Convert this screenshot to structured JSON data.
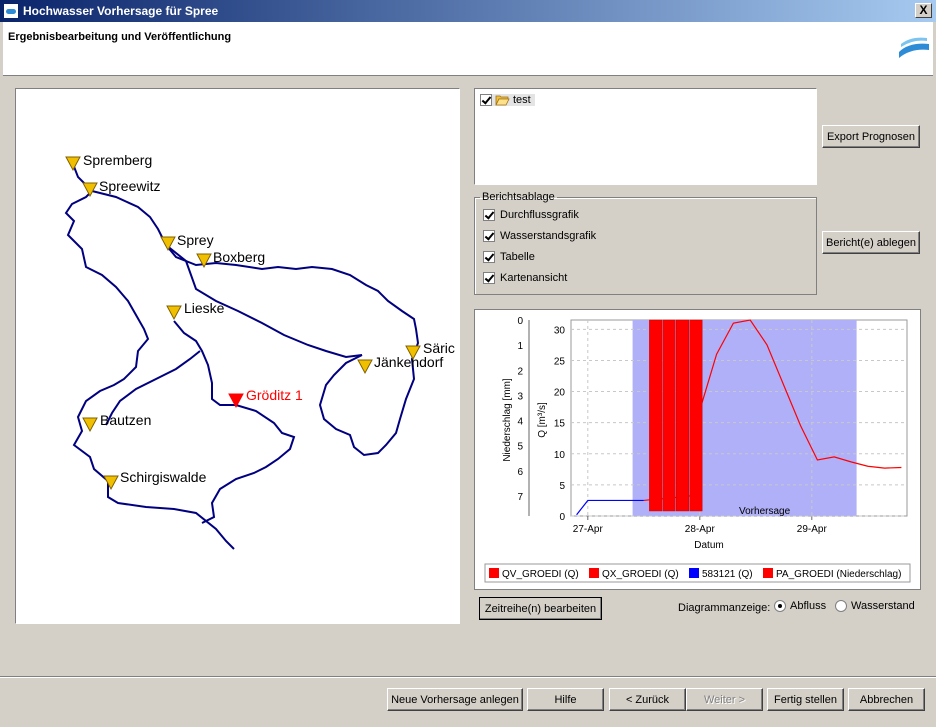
{
  "window": {
    "title": "Hochwasser Vorhersage für Spree",
    "close_label": "X"
  },
  "header": {
    "subtitle": "Ergebnisbearbeitung und Veröffentlichung"
  },
  "map": {
    "stations": [
      {
        "name": "Spremberg",
        "highlight": false
      },
      {
        "name": "Spreewitz",
        "highlight": false
      },
      {
        "name": "Sprey",
        "highlight": false
      },
      {
        "name": "Boxberg",
        "highlight": false
      },
      {
        "name": "Lieske",
        "highlight": false
      },
      {
        "name": "Särichen",
        "label": "Säric",
        "highlight": false
      },
      {
        "name": "Jänkendorf",
        "highlight": false
      },
      {
        "name": "Gröditz 1",
        "highlight": true
      },
      {
        "name": "Bautzen",
        "highlight": false
      },
      {
        "name": "Schirgiswalde",
        "highlight": false
      }
    ],
    "colors": {
      "river": "#000080",
      "station": "#f0c000",
      "highlight": "#ff0000"
    }
  },
  "tree": {
    "item_label": "test",
    "checked": true
  },
  "buttons": {
    "export": "Export Prognosen",
    "berichte": "Bericht(e) ablegen",
    "zeitreihe": "Zeitreihe(n) bearbeiten",
    "neue": "Neue Vorhersage anlegen",
    "hilfe": "Hilfe",
    "zurueck": "< Zurück",
    "weiter": "Weiter >",
    "fertig": "Fertig stellen",
    "abbrechen": "Abbrechen"
  },
  "berichtsablage": {
    "legend": "Berichtsablage",
    "items": [
      {
        "label": "Durchflussgrafik",
        "checked": true
      },
      {
        "label": "Wasserstandsgrafik",
        "checked": true
      },
      {
        "label": "Tabelle",
        "checked": true
      },
      {
        "label": "Kartenansicht",
        "checked": true
      }
    ]
  },
  "diagramm": {
    "label": "Diagrammanzeige:",
    "options": [
      {
        "label": "Abfluss",
        "selected": true
      },
      {
        "label": "Wasserstand",
        "selected": false
      }
    ]
  },
  "chart_data": {
    "type": "line",
    "xlabel": "Datum",
    "ylabel_left": "Niederschlag [mm]",
    "ylabel_right": "Q [m³/s]",
    "x_ticks": [
      "27-Apr",
      "28-Apr",
      "29-Apr"
    ],
    "precip_ticks": [
      0,
      1,
      2,
      3,
      4,
      5,
      6,
      7
    ],
    "q_ticks": [
      0,
      5,
      10,
      15,
      20,
      25,
      30
    ],
    "q_range": [
      0,
      31.5
    ],
    "precip_range": [
      0,
      7.8
    ],
    "x_range_days": [
      -0.15,
      2.85
    ],
    "forecast_region": {
      "start": 0.4,
      "end": 2.4,
      "label": "Vorhersage",
      "color": "#b0b0f8"
    },
    "series": [
      {
        "name": "QV_GROEDI (Q)",
        "color": "#ff0000",
        "kind": "line",
        "x": [
          1.0,
          1.15,
          1.3,
          1.45,
          1.6,
          1.75,
          1.9,
          2.05,
          2.2,
          2.35,
          2.5,
          2.65,
          2.8
        ],
        "y": [
          17,
          26,
          31,
          31.5,
          27.5,
          21,
          14.5,
          9,
          9.5,
          8.7,
          8.0,
          7.7,
          7.8
        ]
      },
      {
        "name": "QX_GROEDI (Q)",
        "color": "#ff0000",
        "kind": "line",
        "x": [
          0.5,
          0.6,
          0.7,
          0.8,
          0.9,
          1.0
        ],
        "y": [
          2.5,
          2.7,
          2.8,
          3.0,
          3.2,
          3.5
        ]
      },
      {
        "name": "583121 (Q)",
        "color": "#0000ff",
        "kind": "line",
        "x": [
          -0.1,
          0.0,
          0.2,
          0.4,
          0.5
        ],
        "y": [
          0.2,
          2.5,
          2.5,
          2.5,
          2.5
        ]
      },
      {
        "name": "PA_GROEDI (Niederschlag)",
        "color": "#ff0000",
        "kind": "bar",
        "x": [
          0.55,
          0.67,
          0.79,
          0.91
        ],
        "y": [
          7.6,
          7.6,
          7.6,
          7.6
        ]
      }
    ]
  }
}
